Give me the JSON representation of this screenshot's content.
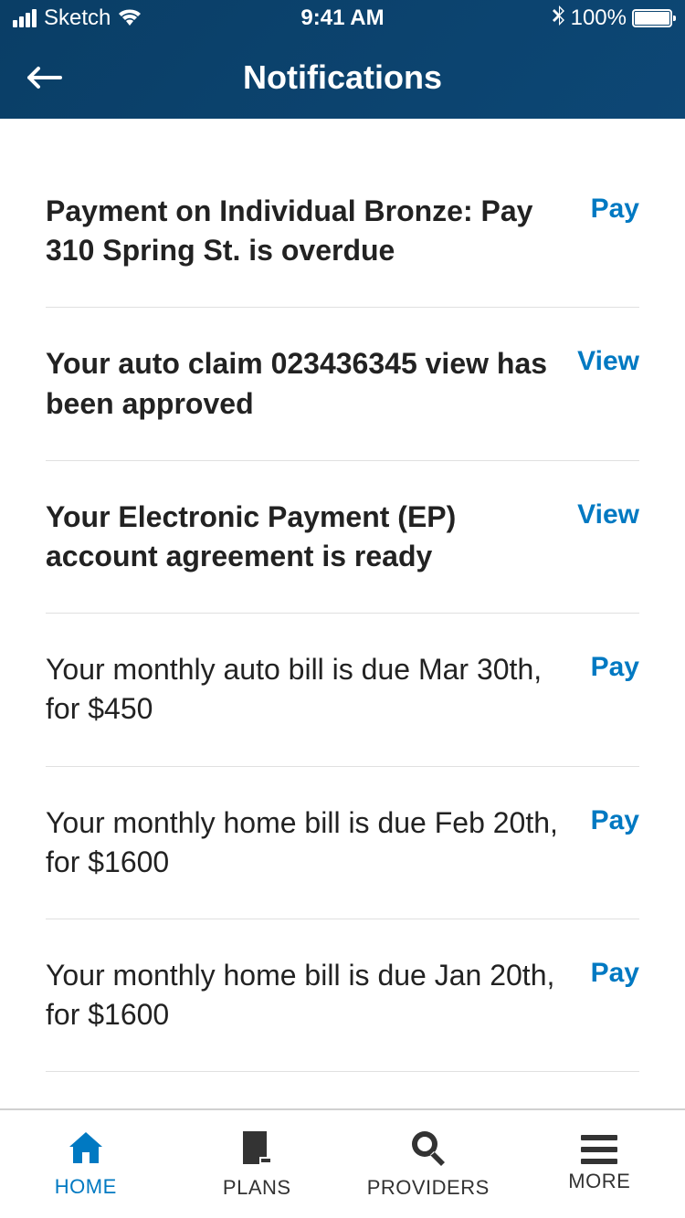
{
  "status_bar": {
    "carrier": "Sketch",
    "time": "9:41 AM",
    "battery": "100%"
  },
  "header": {
    "title": "Notifications"
  },
  "notifications": [
    {
      "text": "Payment on Individual Bronze: Pay 310 Spring St. is overdue",
      "action": "Pay",
      "bold": true
    },
    {
      "text": "Your auto claim 023436345 view has been approved",
      "action": "View",
      "bold": true
    },
    {
      "text": "Your Electronic Payment (EP) account agreement is ready",
      "action": "View",
      "bold": true
    },
    {
      "text": "Your monthly auto bill is due Mar 30th, for $450",
      "action": "Pay",
      "bold": false
    },
    {
      "text": "Your monthly home bill is due Feb 20th, for $1600",
      "action": "Pay",
      "bold": false
    },
    {
      "text": "Your monthly home bill is due Jan 20th, for $1600",
      "action": "Pay",
      "bold": false
    }
  ],
  "tabs": [
    {
      "label": "HOME"
    },
    {
      "label": "PLANS"
    },
    {
      "label": "PROVIDERS"
    },
    {
      "label": "MORE"
    }
  ]
}
